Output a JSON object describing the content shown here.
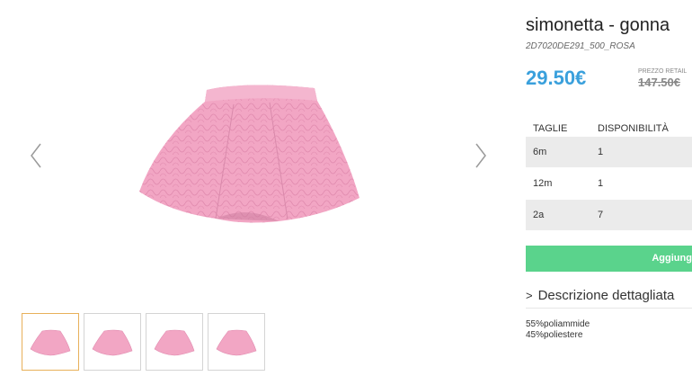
{
  "product": {
    "title": "simonetta - gonna",
    "sku": "2D7020DE291_500_ROSA",
    "price": "29.50€",
    "retail_label": "PREZZO RETAIL",
    "retail_price": "147.50€"
  },
  "sizes": {
    "header_size": "TAGLIE",
    "header_availability": "DISPONIBILITÀ",
    "rows": [
      {
        "size": "6m",
        "availability": "1"
      },
      {
        "size": "12m",
        "availability": "1"
      },
      {
        "size": "2a",
        "availability": "7"
      }
    ]
  },
  "cart": {
    "add_label": "Aggiungi"
  },
  "description": {
    "toggle_label": "Descrizione dettagliata",
    "lines": [
      "55%poliammide",
      "45%poliestere"
    ]
  },
  "gallery": {
    "image_icon": "pink-quilted-skirt",
    "prev_icon": "chevron-left-icon",
    "next_icon": "chevron-right-icon",
    "thumbnail_count": 4,
    "active_thumbnail": 1
  },
  "colors": {
    "price": "#3aa0dc",
    "add_button": "#5ad38c",
    "skirt": "#f2a6c4",
    "active_thumb_border": "#e8b05a"
  }
}
